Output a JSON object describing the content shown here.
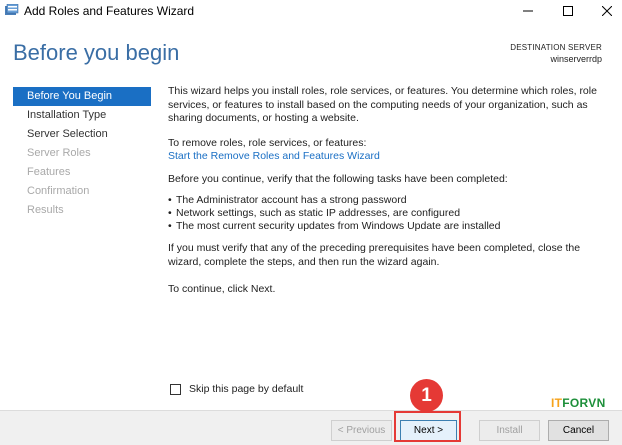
{
  "window": {
    "title": "Add Roles and Features Wizard"
  },
  "header": {
    "page_title": "Before you begin",
    "destination_label": "DESTINATION SERVER",
    "destination_server": "winserverrdp"
  },
  "nav": {
    "items": [
      {
        "label": "Before You Begin",
        "state": "active"
      },
      {
        "label": "Installation Type",
        "state": "enabled"
      },
      {
        "label": "Server Selection",
        "state": "enabled"
      },
      {
        "label": "Server Roles",
        "state": "disabled"
      },
      {
        "label": "Features",
        "state": "disabled"
      },
      {
        "label": "Confirmation",
        "state": "disabled"
      },
      {
        "label": "Results",
        "state": "disabled"
      }
    ]
  },
  "main": {
    "intro": "This wizard helps you install roles, role services, or features. You determine which roles, role services, or features to install based on the computing needs of your organization, such as sharing documents, or hosting a website.",
    "remove_heading": "To remove roles, role services, or features:",
    "remove_link": "Start the Remove Roles and Features Wizard",
    "verify_text": "Before you continue, verify that the following tasks have been completed:",
    "bullets": [
      "The Administrator account has a strong password",
      "Network settings, such as static IP addresses, are configured",
      "The most current security updates from Windows Update are installed"
    ],
    "prereq_text": "If you must verify that any of the preceding prerequisites have been completed, close the wizard, complete the steps, and then run the wizard again.",
    "continue_text": "To continue, click Next.",
    "skip_label": "Skip this page by default"
  },
  "footer": {
    "previous_label": "< Previous",
    "next_label": "Next >",
    "install_label": "Install",
    "cancel_label": "Cancel"
  },
  "annotation": {
    "step_number": "1",
    "highlight_color": "#e53935"
  },
  "watermark": {
    "prefix": "IT",
    "main": "FORVN"
  },
  "colors": {
    "accent": "#1a6fc4",
    "title": "#3a6ea5"
  }
}
